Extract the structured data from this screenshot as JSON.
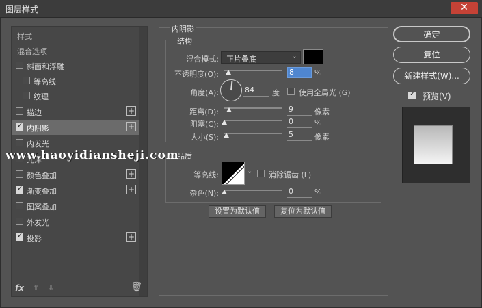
{
  "window": {
    "title": "图层样式",
    "close_glyph": "✕"
  },
  "styles_panel": {
    "items": [
      {
        "label": "样式",
        "checkbox": false
      },
      {
        "label": "混合选项",
        "checkbox": false
      },
      {
        "label": "斜面和浮雕",
        "checkbox": true,
        "checked": false
      },
      {
        "label": "等高线",
        "checkbox": true,
        "checked": false,
        "indent": true
      },
      {
        "label": "纹理",
        "checkbox": true,
        "checked": false,
        "indent": true
      },
      {
        "label": "描边",
        "checkbox": true,
        "checked": false,
        "plus": true
      },
      {
        "label": "内阴影",
        "checkbox": true,
        "checked": true,
        "plus": true,
        "selected": true
      },
      {
        "label": "内发光",
        "checkbox": true,
        "checked": false
      },
      {
        "label": "光泽",
        "checkbox": true,
        "checked": false
      },
      {
        "label": "颜色叠加",
        "checkbox": true,
        "checked": false,
        "plus": true
      },
      {
        "label": "渐变叠加",
        "checkbox": true,
        "checked": true,
        "plus": true
      },
      {
        "label": "图案叠加",
        "checkbox": true,
        "checked": false
      },
      {
        "label": "外发光",
        "checkbox": true,
        "checked": false
      },
      {
        "label": "投影",
        "checkbox": true,
        "checked": true,
        "plus": true
      }
    ],
    "plus_glyph": "+",
    "fx_label": "fx",
    "up_glyph": "⇧",
    "down_glyph": "⇩",
    "trash_glyph": "🗑"
  },
  "inner_shadow": {
    "section_title": "内阴影",
    "structure": {
      "title": "结构",
      "blend_mode_label": "混合模式:",
      "blend_mode_value": "正片叠底",
      "blend_color": "#000000",
      "opacity_label": "不透明度(O):",
      "opacity_value": "8",
      "opacity_unit": "%",
      "opacity_fraction": 0.08,
      "angle_label": "角度(A):",
      "angle_value": "84",
      "angle_unit": "度",
      "global_light_label": "使用全局光 (G)",
      "global_light_checked": false,
      "distance_label": "距离(D):",
      "distance_value": "9",
      "distance_unit": "像素",
      "choke_label": "阻塞(C):",
      "choke_value": "0",
      "choke_unit": "%",
      "size_label": "大小(S):",
      "size_value": "5",
      "size_unit": "像素"
    },
    "quality": {
      "title": "品质",
      "contour_label": "等高线:",
      "antialias_label": "消除锯齿 (L)",
      "antialias_checked": false,
      "noise_label": "杂色(N):",
      "noise_value": "0",
      "noise_unit": "%"
    },
    "set_default_label": "设置为默认值",
    "reset_default_label": "复位为默认值"
  },
  "actions": {
    "ok_label": "确定",
    "reset_label": "复位",
    "new_style_label": "新建样式(W)...",
    "preview_label": "预览(V)",
    "preview_checked": true
  },
  "watermark": "www.haoyidiansheji.com",
  "colors": {
    "background": "#535353",
    "selected_row": "#6b6b6b",
    "highlight_field": "#4f86d0"
  }
}
